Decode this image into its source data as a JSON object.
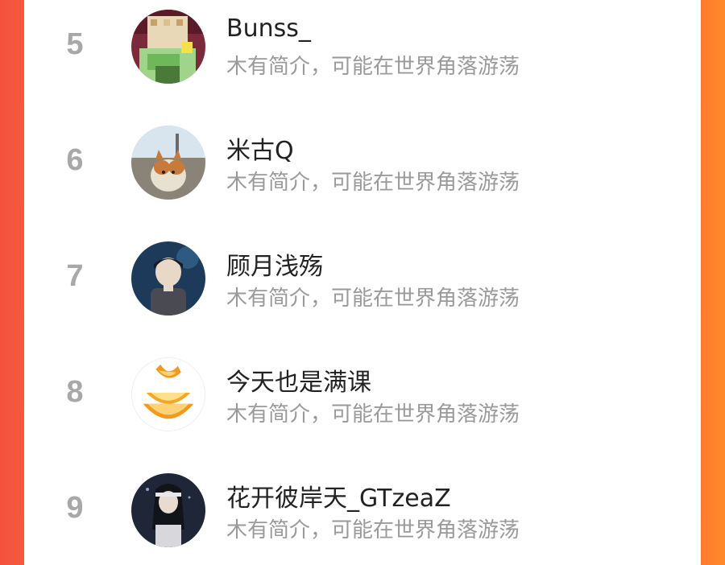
{
  "list": {
    "items": [
      {
        "rank": "5",
        "name": "Bunss_",
        "bio": "木有简介，可能在世界角落游荡",
        "avatar": "minecraft-avatar"
      },
      {
        "rank": "6",
        "name": "米古Q",
        "bio": "木有简介，可能在世界角落游荡",
        "avatar": "cat-avatar"
      },
      {
        "rank": "7",
        "name": "顾月浅殇",
        "bio": "木有简介，可能在世界角落游荡",
        "avatar": "anime-boy-avatar"
      },
      {
        "rank": "8",
        "name": "今天也是满课",
        "bio": "木有简介，可能在世界角落游荡",
        "avatar": "orange-avatar"
      },
      {
        "rank": "9",
        "name": "花开彼岸天_GTzeaZ",
        "bio": "木有简介，可能在世界角落游荡",
        "avatar": "anime-girl-avatar"
      }
    ]
  },
  "colors": {
    "left_border": "#f4503f",
    "right_border": "#ff7a2e",
    "rank": "#a8a8a8",
    "name": "#222222",
    "bio": "#9a9a9a"
  }
}
